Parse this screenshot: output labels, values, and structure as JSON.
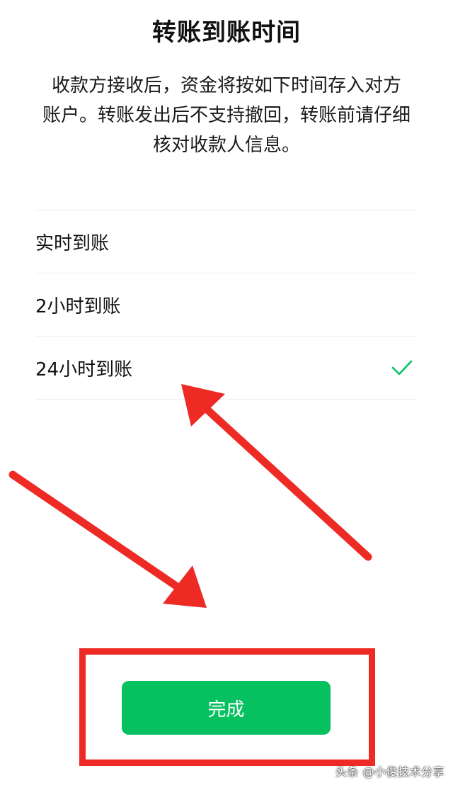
{
  "header": {
    "title": "转账到账时间"
  },
  "description": {
    "line1": "收款方接收后，资金将按如下时间存入对方",
    "line2": "账户。转账发出后不支持撤回，转账前请仔细",
    "line3": "核对收款人信息。"
  },
  "options": [
    {
      "label": "实时到账",
      "selected": false
    },
    {
      "label": "2小时到账",
      "selected": false
    },
    {
      "label": "24小时到账",
      "selected": true
    }
  ],
  "icons": {
    "selected_check": "check-icon"
  },
  "colors": {
    "accent_green": "#07c160",
    "annotation_red": "#ee2a25",
    "divider": "#ededed"
  },
  "footer": {
    "done_label": "完成"
  },
  "watermark": {
    "text": "头条 @小俊技术分享"
  }
}
